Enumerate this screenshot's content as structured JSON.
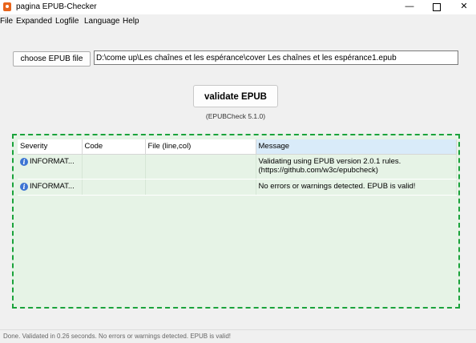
{
  "window": {
    "title": "pagina EPUB-Checker",
    "minimize": "—",
    "close": "✕"
  },
  "menu": [
    "File",
    "Expanded",
    "Logfile",
    "Language",
    "Help"
  ],
  "toolbar": {
    "choose_label": "choose EPUB file",
    "path_value": "D:\\come up\\Les chaînes et les espérance\\cover Les chaînes et les espérance1.epub"
  },
  "validate": {
    "label": "validate EPUB",
    "version": "(EPUBCheck 5.1.0)"
  },
  "results": {
    "columns": [
      "Severity",
      "Code",
      "File (line,col)",
      "Message"
    ],
    "rows": [
      {
        "severity": "INFORMAT...",
        "code": "",
        "file": "",
        "message_line1": "Validating using EPUB version 2.0.1 rules.",
        "message_line2": "(https://github.com/w3c/epubcheck)"
      },
      {
        "severity": "INFORMAT...",
        "code": "",
        "file": "",
        "message_line1": "No errors or warnings detected. EPUB is valid!",
        "message_line2": ""
      }
    ],
    "accent_color": "#1aa33b"
  },
  "status": "Done. Validated in 0.26 seconds. No errors or warnings detected. EPUB is valid!"
}
